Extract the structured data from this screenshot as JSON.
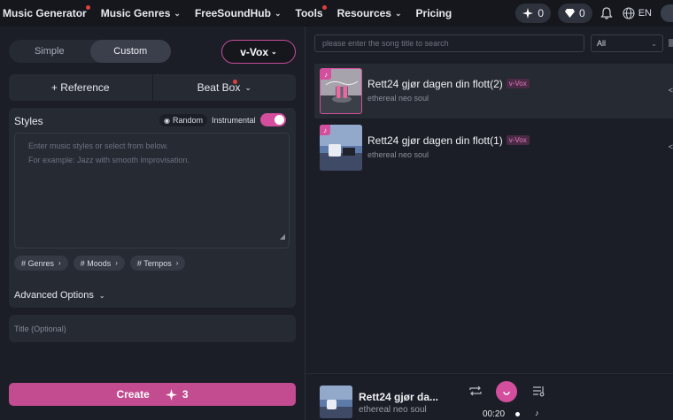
{
  "nav": {
    "items": [
      {
        "label": "Music Generator",
        "dot": true,
        "chevron": false
      },
      {
        "label": "Music Genres",
        "dot": false,
        "chevron": true
      },
      {
        "label": "FreeSoundHub",
        "dot": false,
        "chevron": true
      },
      {
        "label": "Tools",
        "dot": true,
        "chevron": false
      },
      {
        "label": "Resources",
        "dot": false,
        "chevron": true
      },
      {
        "label": "Pricing",
        "dot": false,
        "chevron": false
      }
    ],
    "credits": "0",
    "gems": "0",
    "language": "EN"
  },
  "form": {
    "tab_simple": "Simple",
    "tab_custom": "Custom",
    "model": "v-Vox",
    "reference": "+ Reference",
    "beatbox": "Beat Box",
    "styles_title": "Styles",
    "random": "Random",
    "instrumental": "Instrumental",
    "instrumental_on": true,
    "styles_placeholder_1": "Enter music styles or select from below.",
    "styles_placeholder_2": "For example: Jazz with smooth improvisation.",
    "tags": [
      "# Genres",
      "# Moods",
      "# Tempos"
    ],
    "advanced": "Advanced Options",
    "title_placeholder": "Title (Optional)",
    "create": "Create",
    "create_cost": "3"
  },
  "list": {
    "search_placeholder": "please enter the song title to search",
    "filter": "All",
    "songs": [
      {
        "title": "Rett24 gjør dagen din flott(2)",
        "model": "v-Vox",
        "style": "ethereal neo soul"
      },
      {
        "title": "Rett24 gjør dagen din flott(1)",
        "model": "v-Vox",
        "style": "ethereal neo soul"
      }
    ]
  },
  "player": {
    "title": "Rett24 gjør da...",
    "style": "ethereal neo soul",
    "time": "00:20"
  },
  "colors": {
    "accent": "#d34f9e",
    "background": "#1b1e26",
    "panel": "#262a33"
  }
}
